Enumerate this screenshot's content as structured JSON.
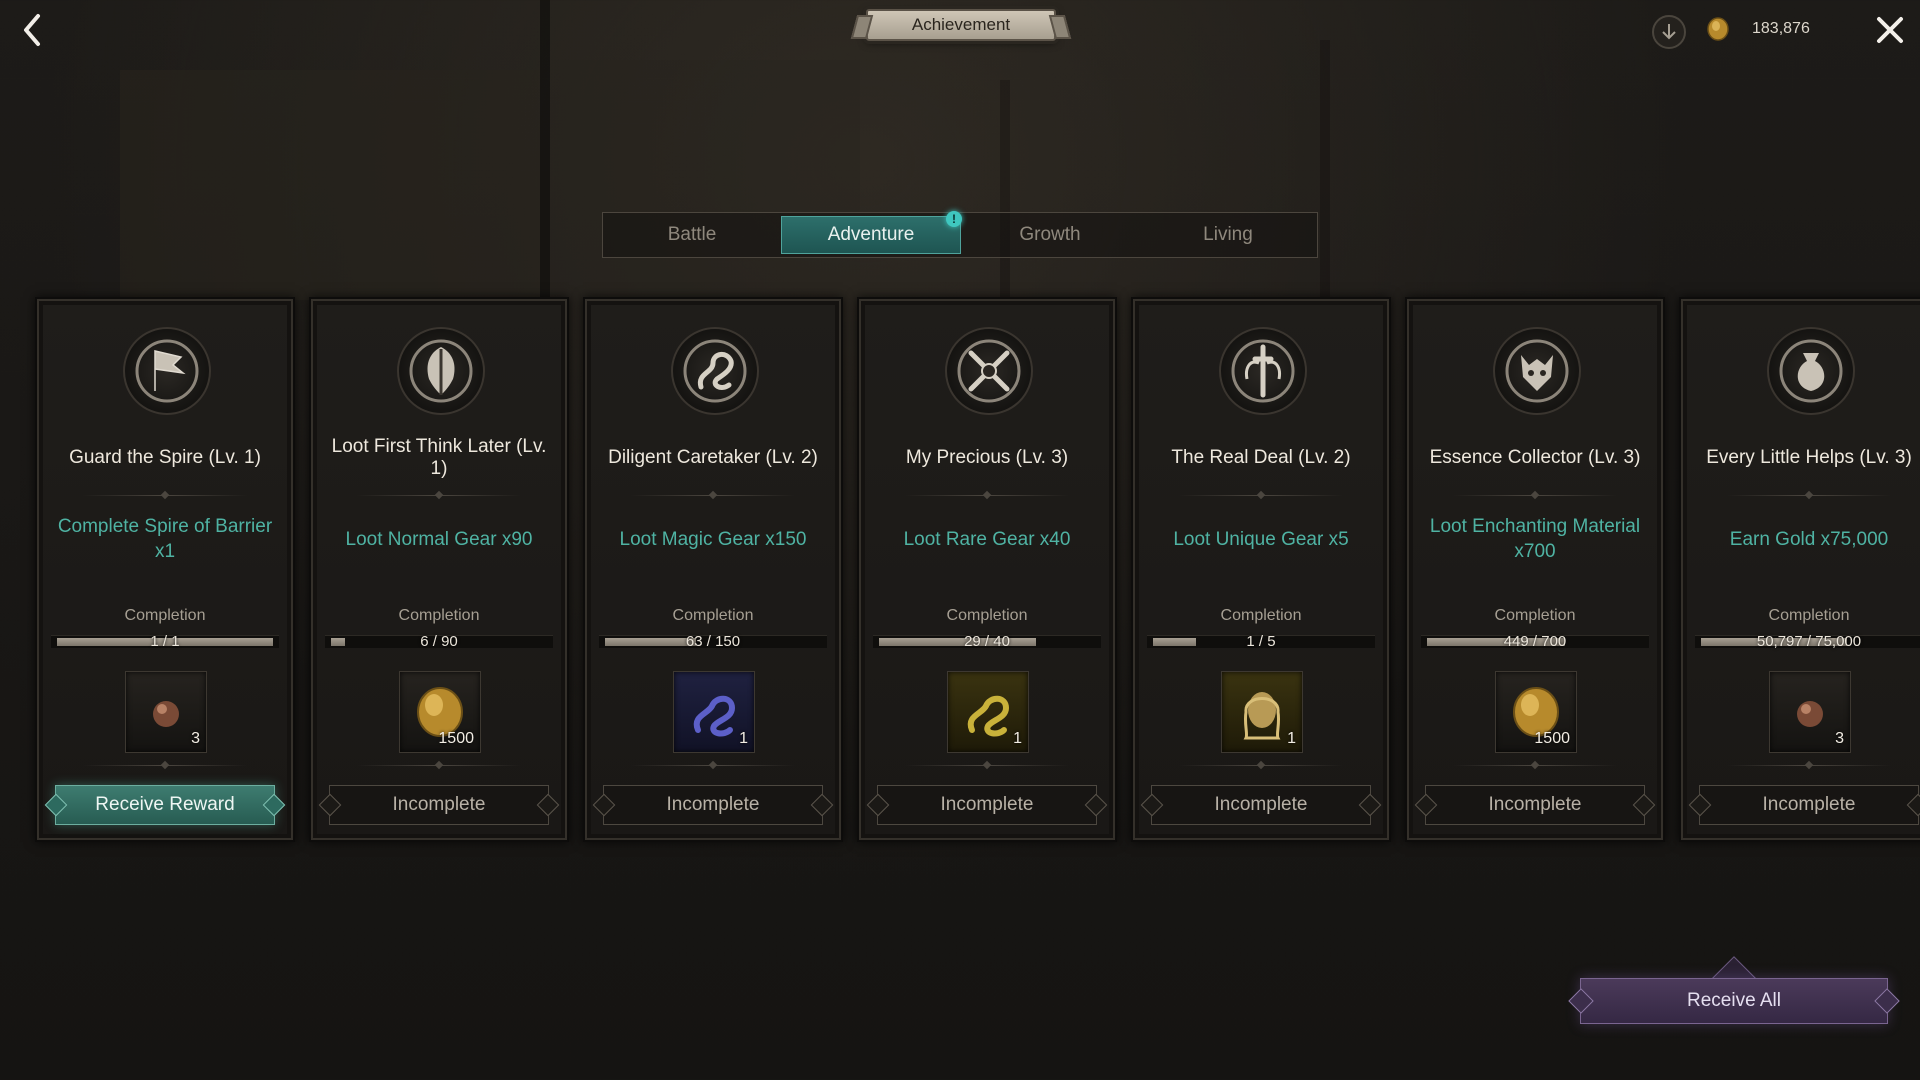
{
  "header": {
    "title": "Achievement",
    "gold_amount": "183,876",
    "back_icon": "chevron-left-icon",
    "close_icon": "close-icon",
    "download_icon": "chevron-down-circle-icon",
    "gold_icon": "gold-coin-icon"
  },
  "tabs": [
    {
      "label": "Battle",
      "active": false
    },
    {
      "label": "Adventure",
      "active": true,
      "badge": "!"
    },
    {
      "label": "Growth",
      "active": false
    },
    {
      "label": "Living",
      "active": false
    }
  ],
  "completion_label": "Completion",
  "cards": [
    {
      "title": "Guard the Spire (Lv. 1)",
      "goal": "Complete Spire of Barrier x1",
      "progress_text": "1 / 1",
      "progress": 1.0,
      "reward_icon": "orb-icon",
      "reward_count": "3",
      "button": "Receive Reward",
      "ready": true,
      "emblem": "flag-emblem-icon"
    },
    {
      "title": "Loot First Think Later (Lv. 1)",
      "goal": "Loot Normal Gear x90",
      "progress_text": "6 / 90",
      "progress": 0.067,
      "reward_icon": "gold-coin-icon",
      "reward_count": "1500",
      "button": "Incomplete",
      "ready": false,
      "emblem": "shield-emblem-icon"
    },
    {
      "title": "Diligent Caretaker (Lv. 2)",
      "goal": "Loot Magic Gear x150",
      "progress_text": "63 / 150",
      "progress": 0.42,
      "reward_icon": "magic-serpent-icon",
      "reward_count": "1",
      "button": "Incomplete",
      "ready": false,
      "emblem": "serpent-emblem-icon"
    },
    {
      "title": "My Precious (Lv. 3)",
      "goal": "Loot Rare Gear x40",
      "progress_text": "29 / 40",
      "progress": 0.725,
      "reward_icon": "rare-serpent-icon",
      "reward_count": "1",
      "button": "Incomplete",
      "ready": false,
      "emblem": "crossed-swords-emblem-icon"
    },
    {
      "title": "The Real Deal (Lv. 2)",
      "goal": "Loot Unique Gear x5",
      "progress_text": "1 / 5",
      "progress": 0.2,
      "reward_icon": "unique-portrait-icon",
      "reward_count": "1",
      "button": "Incomplete",
      "ready": false,
      "emblem": "sword-wings-emblem-icon"
    },
    {
      "title": "Essence Collector (Lv. 3)",
      "goal": "Loot Enchanting Material x700",
      "progress_text": "449 / 700",
      "progress": 0.641,
      "reward_icon": "gold-coin-icon",
      "reward_count": "1500",
      "button": "Incomplete",
      "ready": false,
      "emblem": "beast-head-emblem-icon"
    },
    {
      "title": "Every Little Helps (Lv. 3)",
      "goal": "Earn Gold x75,000",
      "progress_text": "50,797 / 75,000",
      "progress": 0.677,
      "reward_icon": "orb-icon",
      "reward_count": "3",
      "button": "Incomplete",
      "ready": false,
      "emblem": "gold-sack-emblem-icon"
    }
  ],
  "receive_all_label": "Receive All"
}
